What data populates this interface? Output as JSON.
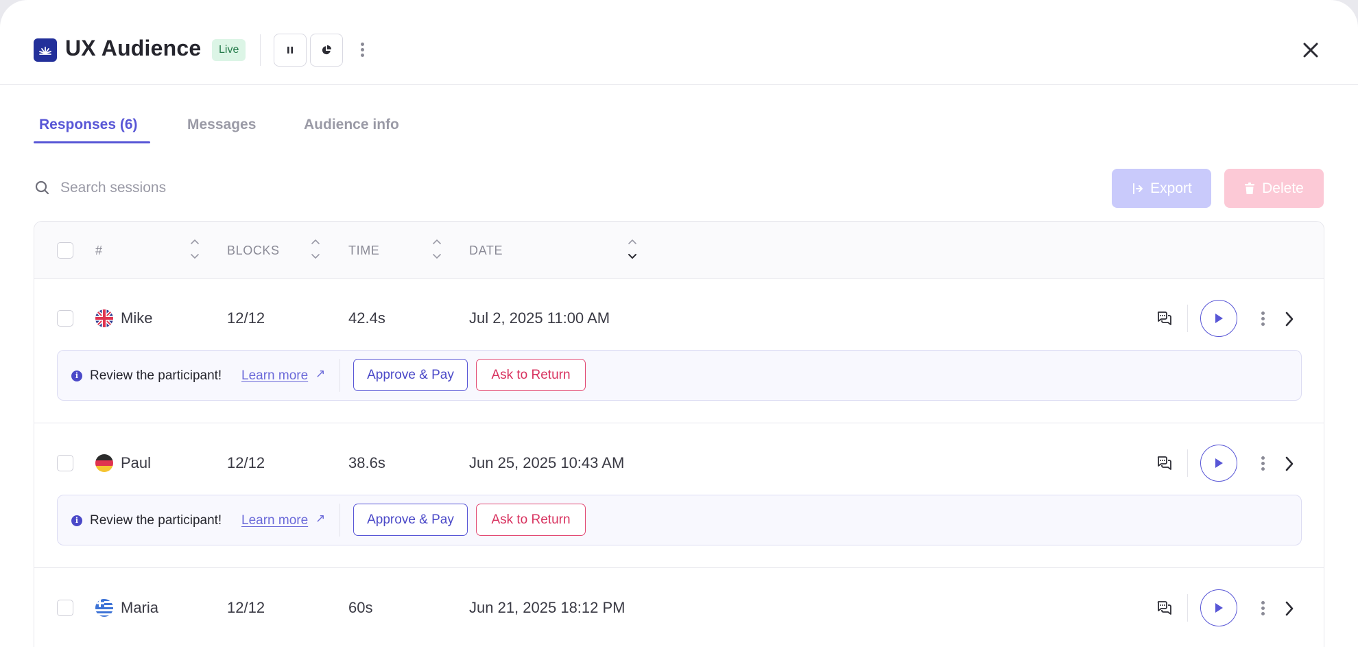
{
  "header": {
    "title": "UX Audience",
    "status_badge": "Live"
  },
  "tabs": [
    {
      "label": "Responses (6)",
      "active": true
    },
    {
      "label": "Messages",
      "active": false
    },
    {
      "label": "Audience info",
      "active": false
    }
  ],
  "toolbar": {
    "search_placeholder": "Search sessions",
    "export_label": "Export",
    "delete_label": "Delete"
  },
  "table": {
    "columns": [
      "#",
      "BLOCKS",
      "TIME",
      "DATE"
    ],
    "rows": [
      {
        "name": "Mike",
        "flag": "uk-flag-icon",
        "blocks": "12/12",
        "time": "42.4s",
        "date": "Jul 2, 2025 11:00 AM"
      },
      {
        "name": "Paul",
        "flag": "germany-flag-icon",
        "blocks": "12/12",
        "time": "38.6s",
        "date": "Jun 25, 2025 10:43 AM"
      },
      {
        "name": "Maria",
        "flag": "greece-flag-icon",
        "blocks": "12/12",
        "time": "60s",
        "date": "Jun 21, 2025 18:12 PM"
      }
    ]
  },
  "review": {
    "text": "Review the participant!",
    "learn_more": "Learn more",
    "approve_label": "Approve & Pay",
    "return_label": "Ask to Return"
  },
  "colors": {
    "accent": "#5856d6",
    "danger": "#e24a74",
    "live": "#247a4a"
  }
}
